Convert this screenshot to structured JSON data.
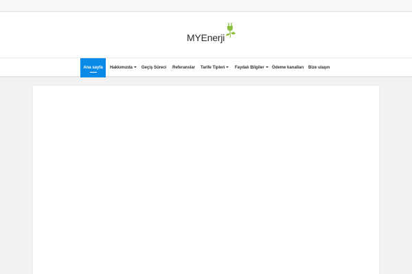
{
  "brand": {
    "logo_text": "MYEnerji",
    "logo_icon": "plug-leaf-icon",
    "accent_color": "#0a8ae8",
    "leaf_color": "#8cbf3f"
  },
  "nav": {
    "items": [
      {
        "label": "Ana sayfa",
        "active": true,
        "dropdown": false
      },
      {
        "label": "Hakkımızda",
        "active": false,
        "dropdown": true
      },
      {
        "label": "Geçiş Süreci",
        "active": false,
        "dropdown": false
      },
      {
        "label": "Referanslar",
        "active": false,
        "dropdown": false
      },
      {
        "label": "Tarife Tipleri",
        "active": false,
        "dropdown": true
      },
      {
        "label": "Faydalı Bilgiler",
        "active": false,
        "dropdown": true
      },
      {
        "label": "Ödeme kanalları",
        "active": false,
        "dropdown": false
      },
      {
        "label": "Bize ulaşın",
        "active": false,
        "dropdown": false
      }
    ]
  }
}
